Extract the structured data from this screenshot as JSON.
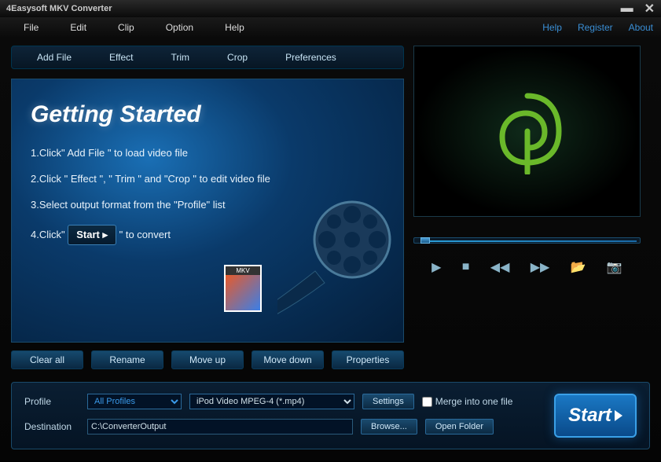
{
  "title": "4Easysoft MKV Converter",
  "menu": {
    "file": "File",
    "edit": "Edit",
    "clip": "Clip",
    "option": "Option",
    "help": "Help"
  },
  "links": {
    "help": "Help",
    "register": "Register",
    "about": "About"
  },
  "toolbar": {
    "addfile": "Add File",
    "effect": "Effect",
    "trim": "Trim",
    "crop": "Crop",
    "preferences": "Preferences"
  },
  "getting_started": {
    "title": "Getting Started",
    "line1": "1.Click\" Add File \" to load video file",
    "line2": "2.Click \" Effect \", \" Trim \" and \"Crop \" to edit video file",
    "line3": "3.Select output format from the \"Profile\" list",
    "line4_pre": "4.Click\" ",
    "line4_btn": "Start",
    "line4_post": " \" to convert",
    "mkv_badge": "MKV"
  },
  "actions": {
    "clearall": "Clear all",
    "rename": "Rename",
    "moveup": "Move up",
    "movedown": "Move down",
    "properties": "Properties"
  },
  "profile": {
    "label": "Profile",
    "category": "All Profiles",
    "format": "iPod Video MPEG-4 (*.mp4)",
    "settings": "Settings",
    "merge": "Merge into one file"
  },
  "destination": {
    "label": "Destination",
    "path": "C:\\ConverterOutput",
    "browse": "Browse...",
    "openfolder": "Open Folder"
  },
  "start": "Start"
}
